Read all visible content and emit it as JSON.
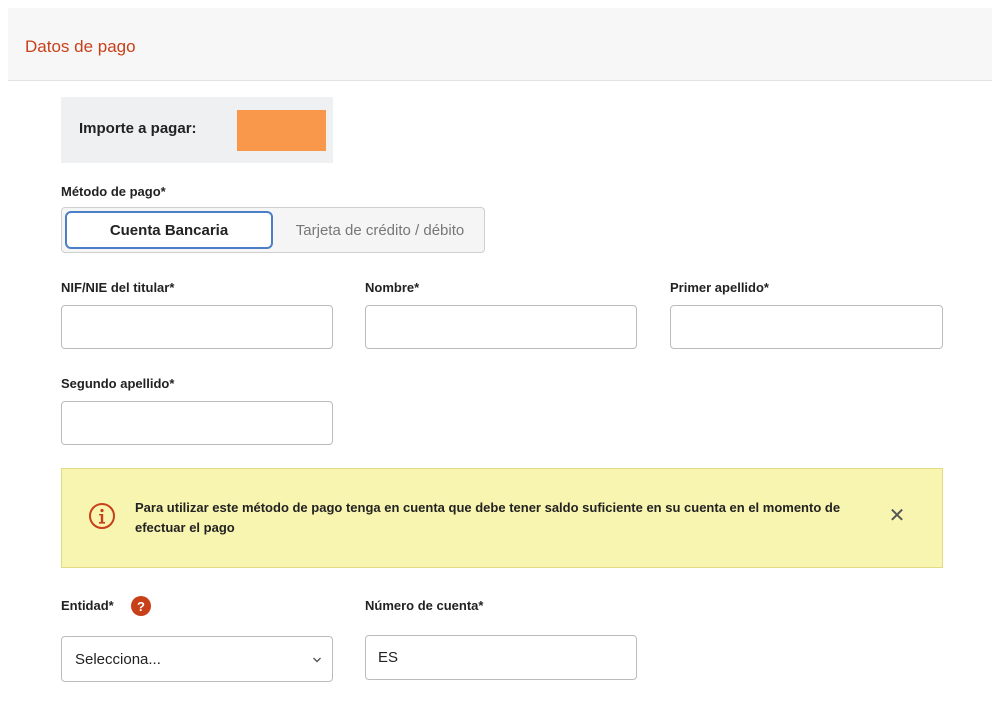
{
  "panel": {
    "title": "Datos de pago"
  },
  "amount": {
    "label": "Importe a pagar:",
    "value_color": "#f9984a"
  },
  "payment_method": {
    "label": "Método de pago*",
    "options": [
      "Cuenta Bancaria",
      "Tarjeta de crédito / débito"
    ],
    "selected": "Cuenta Bancaria"
  },
  "fields": {
    "nif": {
      "label": "NIF/NIE del titular*",
      "value": ""
    },
    "nombre": {
      "label": "Nombre*",
      "value": ""
    },
    "primer_apellido": {
      "label": "Primer apellido*",
      "value": ""
    },
    "segundo_apellido": {
      "label": "Segundo apellido*",
      "value": ""
    }
  },
  "alert": {
    "text": "Para utilizar este método de pago tenga en cuenta que debe tener saldo suficiente en su cuenta en el momento de efectuar el pago",
    "icon": "info-circle-icon",
    "close_icon": "close-icon"
  },
  "entidad": {
    "label": "Entidad*",
    "help": "?",
    "selected": "Selecciona..."
  },
  "numero_cuenta": {
    "label": "Número de cuenta*",
    "value": "ES"
  },
  "colors": {
    "accent": "#c8401a",
    "alert_bg": "#f8f5b0",
    "selected_border": "#4a7fc8"
  }
}
